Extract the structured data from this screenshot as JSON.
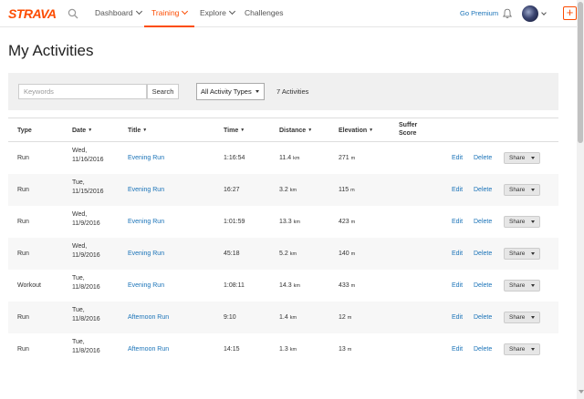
{
  "header": {
    "logo": "STRAVA",
    "nav": [
      {
        "label": "Dashboard",
        "has_caret": true
      },
      {
        "label": "Training",
        "has_caret": true
      },
      {
        "label": "Explore",
        "has_caret": true
      },
      {
        "label": "Challenges",
        "has_caret": false
      }
    ],
    "go_premium": "Go Premium",
    "plus": "+"
  },
  "page": {
    "title": "My Activities"
  },
  "filters": {
    "keyword_placeholder": "Keywords",
    "search_label": "Search",
    "type_select": "All Activity Types",
    "count": "7 Activities"
  },
  "table": {
    "headers": {
      "type": "Type",
      "date": "Date",
      "title": "Title",
      "time": "Time",
      "distance": "Distance",
      "elevation": "Elevation",
      "suffer_line1": "Suffer",
      "suffer_line2": "Score"
    },
    "sort_glyph": "▼",
    "edit_label": "Edit",
    "delete_label": "Delete",
    "share_label": "Share",
    "rows": [
      {
        "type": "Run",
        "day": "Wed,",
        "date": "11/16/2016",
        "title": "Evening Run",
        "time": "1:16:54",
        "distance": "11.4",
        "distance_unit": "km",
        "elevation": "271",
        "elevation_unit": "m"
      },
      {
        "type": "Run",
        "day": "Tue,",
        "date": "11/15/2016",
        "title": "Evening Run",
        "time": "16:27",
        "distance": "3.2",
        "distance_unit": "km",
        "elevation": "115",
        "elevation_unit": "m"
      },
      {
        "type": "Run",
        "day": "Wed,",
        "date": "11/9/2016",
        "title": "Evening Run",
        "time": "1:01:59",
        "distance": "13.3",
        "distance_unit": "km",
        "elevation": "423",
        "elevation_unit": "m"
      },
      {
        "type": "Run",
        "day": "Wed,",
        "date": "11/9/2016",
        "title": "Evening Run",
        "time": "45:18",
        "distance": "5.2",
        "distance_unit": "km",
        "elevation": "140",
        "elevation_unit": "m"
      },
      {
        "type": "Workout",
        "day": "Tue,",
        "date": "11/8/2016",
        "title": "Evening Run",
        "time": "1:08:11",
        "distance": "14.3",
        "distance_unit": "km",
        "elevation": "433",
        "elevation_unit": "m"
      },
      {
        "type": "Run",
        "day": "Tue,",
        "date": "11/8/2016",
        "title": "Afternoon Run",
        "time": "9:10",
        "distance": "1.4",
        "distance_unit": "km",
        "elevation": "12",
        "elevation_unit": "m"
      },
      {
        "type": "Run",
        "day": "Tue,",
        "date": "11/8/2016",
        "title": "Afternoon Run",
        "time": "14:15",
        "distance": "1.3",
        "distance_unit": "km",
        "elevation": "13",
        "elevation_unit": "m"
      }
    ]
  },
  "colors": {
    "brand": "#fc4c02",
    "link": "#1a73b8"
  },
  "icons": [
    "search-icon",
    "bell-icon",
    "avatar",
    "plus-icon",
    "chevron-down-icon"
  ]
}
